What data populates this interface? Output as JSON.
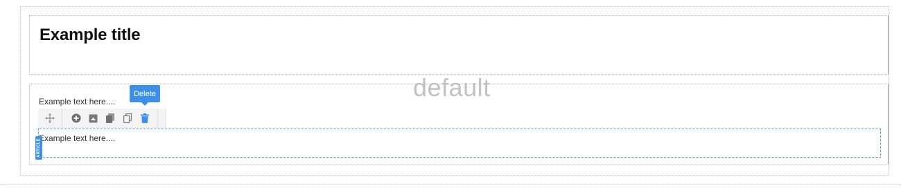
{
  "editor": {
    "layout_label": "default",
    "title": "Example title",
    "text_1": "Example text here....",
    "text_2": "Example text here....",
    "article_tag": "ARTICLE"
  },
  "toolbar": {
    "move_icon": "move-icon",
    "tools": [
      {
        "name": "add-icon"
      },
      {
        "name": "image-icon"
      },
      {
        "name": "copy-icon"
      },
      {
        "name": "duplicate-icon"
      },
      {
        "name": "trash-icon"
      }
    ],
    "tooltip": "Delete"
  },
  "colors": {
    "accent": "#3d8fe8",
    "icon_gray": "#7a7a7a",
    "watermark_gray": "#c2c2c2"
  }
}
